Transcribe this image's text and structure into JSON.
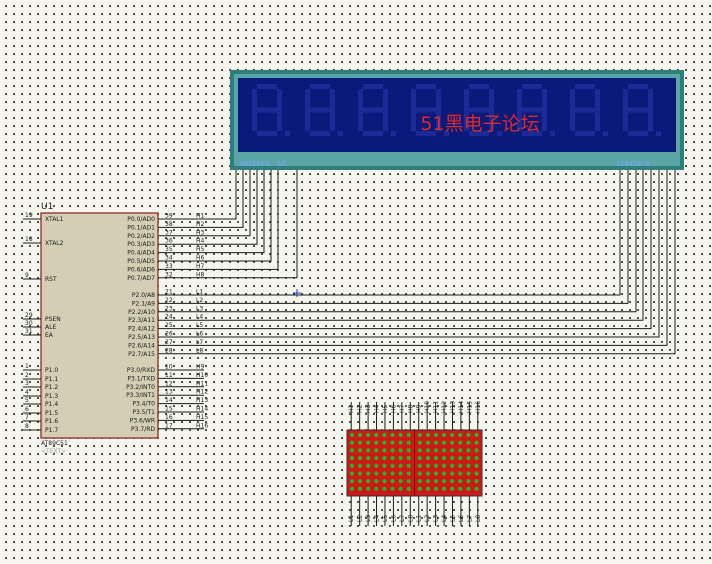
{
  "chip": {
    "ref": "U1",
    "part": "AT89C51",
    "text_placeholder": "<TEXT>",
    "left_pins": [
      {
        "num": "19",
        "name": "XTAL1"
      },
      {
        "num": "18",
        "name": "XTAL2"
      },
      {
        "num": "9",
        "name": "RST"
      },
      {
        "num": "29",
        "name": "PSEN"
      },
      {
        "num": "30",
        "name": "ALE"
      },
      {
        "num": "31",
        "name": "EA"
      },
      {
        "num": "1",
        "name": "P1.0"
      },
      {
        "num": "2",
        "name": "P1.1"
      },
      {
        "num": "3",
        "name": "P1.2"
      },
      {
        "num": "4",
        "name": "P1.3"
      },
      {
        "num": "5",
        "name": "P1.4"
      },
      {
        "num": "6",
        "name": "P1.5"
      },
      {
        "num": "7",
        "name": "P1.6"
      },
      {
        "num": "8",
        "name": "P1.7"
      }
    ],
    "right_pins_p0": [
      {
        "num": "39",
        "name": "P0.0/AD0",
        "net": "H1"
      },
      {
        "num": "38",
        "name": "P0.1/AD1",
        "net": "H2"
      },
      {
        "num": "37",
        "name": "P0.2/AD2",
        "net": "H3"
      },
      {
        "num": "36",
        "name": "P0.3/AD3",
        "net": "H4"
      },
      {
        "num": "35",
        "name": "P0.4/AD4",
        "net": "H5"
      },
      {
        "num": "34",
        "name": "P0.5/AD5",
        "net": "H6"
      },
      {
        "num": "33",
        "name": "P0.6/AD6",
        "net": "H7"
      },
      {
        "num": "32",
        "name": "P0.7/AD7",
        "net": "H8"
      }
    ],
    "right_pins_p2": [
      {
        "num": "21",
        "name": "P2.0/A8",
        "net": "L1"
      },
      {
        "num": "22",
        "name": "P2.1/A9",
        "net": "L2"
      },
      {
        "num": "23",
        "name": "P2.2/A10",
        "net": "L3"
      },
      {
        "num": "24",
        "name": "P2.3/A11",
        "net": "L4"
      },
      {
        "num": "25",
        "name": "P2.4/A12",
        "net": "L5"
      },
      {
        "num": "26",
        "name": "P2.5/A13",
        "net": "L6"
      },
      {
        "num": "27",
        "name": "P2.6/A14",
        "net": "L7"
      },
      {
        "num": "28",
        "name": "P2.7/A15",
        "net": "L8"
      }
    ],
    "right_pins_p3": [
      {
        "num": "10",
        "name": "P3.0/RXD",
        "net": "H9"
      },
      {
        "num": "11",
        "name": "P3.1/TXD",
        "net": "H10"
      },
      {
        "num": "12",
        "name": "P3.2/INT0",
        "net": "H11"
      },
      {
        "num": "13",
        "name": "P3.3/INT1",
        "net": "H12"
      },
      {
        "num": "14",
        "name": "P3.4/T0",
        "net": "H13"
      },
      {
        "num": "15",
        "name": "P3.5/T1",
        "net": "H14"
      },
      {
        "num": "16",
        "name": "P3.6/WR",
        "net": "H15"
      },
      {
        "num": "17",
        "name": "P3.7/RD",
        "net": "H16"
      }
    ]
  },
  "display": {
    "overlay_text": "51黑电子论坛",
    "segment_pins_label": "ABCDEFG  DP",
    "digit_pins_label": "12345678",
    "digit_count": 8
  },
  "matrix": {
    "top_labels": [
      "H1",
      "H2",
      "H3",
      "H4",
      "H5",
      "H6",
      "H7",
      "H8",
      "H9",
      "H10",
      "H11",
      "H12",
      "H13",
      "H14",
      "H15",
      "H16"
    ],
    "bottom_labels": [
      "L1",
      "L2",
      "L3",
      "L4",
      "L5",
      "L6",
      "L7",
      "L8",
      "L1",
      "L2",
      "L3",
      "L4",
      "L5",
      "L6",
      "L7",
      "L8"
    ],
    "rows": 8,
    "cols": 16
  },
  "colors": {
    "body_fill": "#d4ceb4",
    "body_stroke": "#8b1a1a",
    "wire": "#1a1a1a",
    "lcd_frame": "#2f7f7f",
    "lcd_bg": "#0a1a7a",
    "lcd_segment": "#1c2a98",
    "overlay_text": "#e02828",
    "led_on": "#22b822",
    "matrix_bg": "#cc1818"
  }
}
